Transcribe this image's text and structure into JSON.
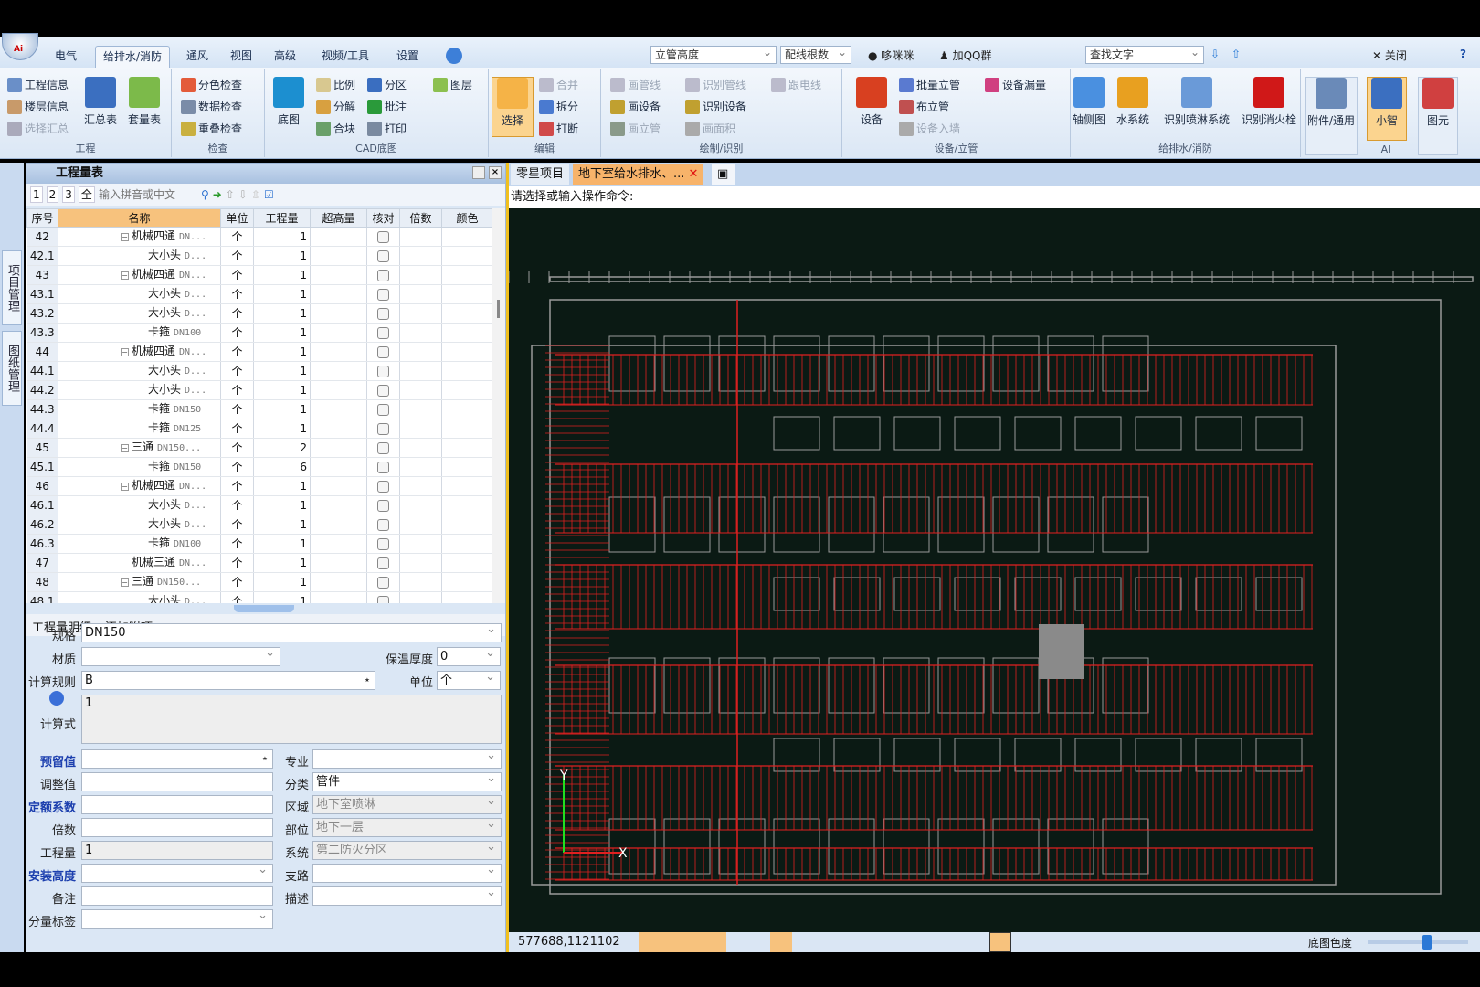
{
  "app": {
    "logo_text": "Ai"
  },
  "menu": {
    "tabs": [
      "电气",
      "给排水/消防",
      "通风",
      "视图",
      "高级",
      "视频/工具",
      "设置"
    ],
    "active": "给排水/消防"
  },
  "quickbar": {
    "riser_height": "立管高度",
    "wire_count": "配线根数",
    "duomi": "哆咪咪",
    "qq_group": "加QQ群",
    "find_text": "查找文字",
    "close": "关闭"
  },
  "ribbon": {
    "groups": [
      "工程",
      "检查",
      "CAD底图",
      "编辑",
      "绘制/识别",
      "设备/立管",
      "给排水/消防",
      "AI"
    ],
    "project": [
      "工程信息",
      "楼层信息",
      "选择汇总",
      "汇总表",
      "套量表"
    ],
    "check": [
      "分色检查",
      "数据检查",
      "重叠检查"
    ],
    "cad": [
      "底图",
      "比例",
      "分区",
      "图层",
      "分解",
      "批注",
      "合块",
      "打印"
    ],
    "edit": [
      "选择",
      "合并",
      "拆分",
      "打断"
    ],
    "draw": [
      "画管线",
      "识别管线",
      "跟电线",
      "画设备",
      "识别设备",
      "画立管",
      "画面积"
    ],
    "equip": [
      "设备",
      "批量立管",
      "设备漏量",
      "布立管",
      "设备入墙"
    ],
    "water": [
      "轴侧图",
      "水系统",
      "识别喷淋系统",
      "识别消火栓"
    ],
    "misc": [
      "附件/通用",
      "小智",
      "图元"
    ]
  },
  "panel": {
    "title": "工程量表",
    "levels": [
      "1",
      "2",
      "3",
      "全"
    ],
    "search_placeholder": "输入拼音或中文",
    "side_tabs": [
      "项目管理",
      "图纸管理"
    ]
  },
  "grid": {
    "columns": [
      "序号",
      "名称",
      "单位",
      "工程量",
      "超高量",
      "核对",
      "倍数",
      "颜色"
    ],
    "rows": [
      {
        "seq": "42",
        "name": "机械四通",
        "spec": "DN...",
        "level": 1,
        "unit": "个",
        "qty": "1"
      },
      {
        "seq": "42.1",
        "name": "大小头",
        "spec": "D...",
        "level": 2,
        "unit": "个",
        "qty": "1"
      },
      {
        "seq": "43",
        "name": "机械四通",
        "spec": "DN...",
        "level": 1,
        "unit": "个",
        "qty": "1"
      },
      {
        "seq": "43.1",
        "name": "大小头",
        "spec": "D...",
        "level": 2,
        "unit": "个",
        "qty": "1"
      },
      {
        "seq": "43.2",
        "name": "大小头",
        "spec": "D...",
        "level": 2,
        "unit": "个",
        "qty": "1"
      },
      {
        "seq": "43.3",
        "name": "卡箍",
        "spec": "DN100",
        "level": 2,
        "unit": "个",
        "qty": "1"
      },
      {
        "seq": "44",
        "name": "机械四通",
        "spec": "DN...",
        "level": 1,
        "unit": "个",
        "qty": "1"
      },
      {
        "seq": "44.1",
        "name": "大小头",
        "spec": "D...",
        "level": 2,
        "unit": "个",
        "qty": "1"
      },
      {
        "seq": "44.2",
        "name": "大小头",
        "spec": "D...",
        "level": 2,
        "unit": "个",
        "qty": "1"
      },
      {
        "seq": "44.3",
        "name": "卡箍",
        "spec": "DN150",
        "level": 2,
        "unit": "个",
        "qty": "1"
      },
      {
        "seq": "44.4",
        "name": "卡箍",
        "spec": "DN125",
        "level": 2,
        "unit": "个",
        "qty": "1"
      },
      {
        "seq": "45",
        "name": "三通",
        "spec": "DN150...",
        "level": 1,
        "unit": "个",
        "qty": "2"
      },
      {
        "seq": "45.1",
        "name": "卡箍",
        "spec": "DN150",
        "level": 2,
        "unit": "个",
        "qty": "6"
      },
      {
        "seq": "46",
        "name": "机械四通",
        "spec": "DN...",
        "level": 1,
        "unit": "个",
        "qty": "1"
      },
      {
        "seq": "46.1",
        "name": "大小头",
        "spec": "D...",
        "level": 2,
        "unit": "个",
        "qty": "1"
      },
      {
        "seq": "46.2",
        "name": "大小头",
        "spec": "D...",
        "level": 2,
        "unit": "个",
        "qty": "1"
      },
      {
        "seq": "46.3",
        "name": "卡箍",
        "spec": "DN100",
        "level": 2,
        "unit": "个",
        "qty": "1"
      },
      {
        "seq": "47",
        "name": "机械三通",
        "spec": "DN...",
        "level": 1,
        "unit": "个",
        "qty": "1",
        "leaf": true
      },
      {
        "seq": "48",
        "name": "三通",
        "spec": "DN150...",
        "level": 1,
        "unit": "个",
        "qty": "1"
      },
      {
        "seq": "48.1",
        "name": "大小头",
        "spec": "D...",
        "level": 2,
        "unit": "个",
        "qty": "1"
      }
    ]
  },
  "detail": {
    "tabs": [
      "工程量明细",
      "添加附项"
    ],
    "spec_label": "规格",
    "spec": "DN150",
    "material_label": "材质",
    "material": "",
    "insulation_label": "保温厚度",
    "insulation": "0",
    "rule_label": "计算规则",
    "rule": "B",
    "unit_label": "单位",
    "unit": "个",
    "formula_label": "计算式",
    "formula": "1",
    "reserve_label": "预留值",
    "adjust_label": "调整值",
    "quota_label": "定额系数",
    "multiple_label": "倍数",
    "qty_label": "工程量",
    "qty": "1",
    "height_label": "安装高度",
    "remark_label": "备注",
    "tag_label": "分量标签",
    "major_label": "专业",
    "category_label": "分类",
    "category": "管件",
    "area_label": "区域",
    "area": "地下室喷淋",
    "part_label": "部位",
    "part": "地下一层",
    "system_label": "系统",
    "system": "第二防火分区",
    "branch_label": "支路",
    "desc_label": "描述"
  },
  "doc": {
    "tabs": [
      "零星项目",
      "地下室给水排水、..."
    ],
    "command_prompt": "请选择或输入操作命令:"
  },
  "status": {
    "coords": "577688,1121102",
    "bg_color_label": "底图色度",
    "bg_color_level": 0.6
  },
  "colors": {
    "canvas_bg": "#0b1a14",
    "pipe": "#e02020",
    "outline": "#9a9a9a",
    "accent": "#f7c27d"
  }
}
